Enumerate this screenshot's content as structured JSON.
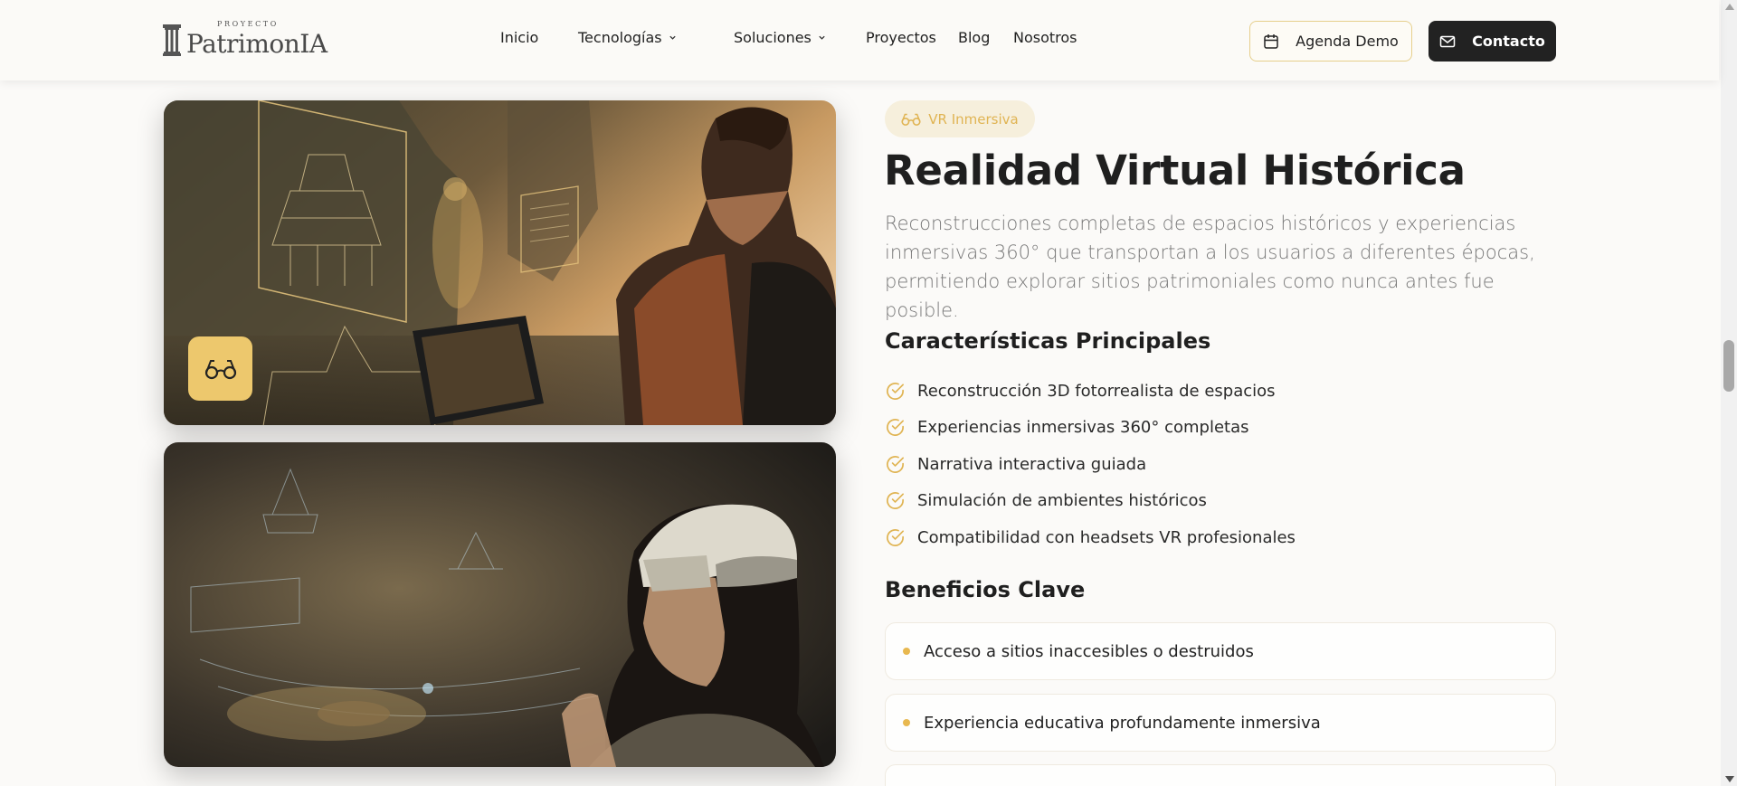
{
  "header": {
    "logo_top": "PROYECTO",
    "logo_main": "PatrimonIA",
    "nav": [
      {
        "label": "Inicio",
        "dropdown": false
      },
      {
        "label": "Tecnologías",
        "dropdown": true
      },
      {
        "label": "Soluciones",
        "dropdown": true
      },
      {
        "label": "Proyectos",
        "dropdown": false
      },
      {
        "label": "Blog",
        "dropdown": false
      },
      {
        "label": "Nosotros",
        "dropdown": false
      }
    ],
    "demo_button": {
      "label": "Agenda Demo",
      "icon": "calendar-icon"
    },
    "contact_button": {
      "label": "Contacto",
      "icon": "mail-icon"
    }
  },
  "media": {
    "card1_icon": "glasses-icon",
    "card2": "vr-headset-photo"
  },
  "content": {
    "tag": {
      "label": "VR Inmersiva",
      "icon": "glasses-icon"
    },
    "title": "Realidad Virtual Histórica",
    "lead": "Reconstrucciones completas de espacios históricos y experiencias inmersivas 360° que transportan a los usuarios a diferentes épocas, permitiendo explorar sitios patrimoniales como nunca antes fue posible.",
    "features_heading": "Características Principales",
    "features": [
      "Reconstrucción 3D fotorrealista de espacios",
      "Experiencias inmersivas 360° completas",
      "Narrativa interactiva guiada",
      "Simulación de ambientes históricos",
      "Compatibilidad con headsets VR profesionales"
    ],
    "benefits_heading": "Beneficios Clave",
    "benefits": [
      "Acceso a sitios inaccesibles o destruidos",
      "Experiencia educativa profundamente inmersiva",
      ""
    ]
  },
  "colors": {
    "accent": "#edc86d",
    "accent_text": "#e0b453",
    "dark_button": "#222222",
    "background": "#fbfaf8"
  }
}
